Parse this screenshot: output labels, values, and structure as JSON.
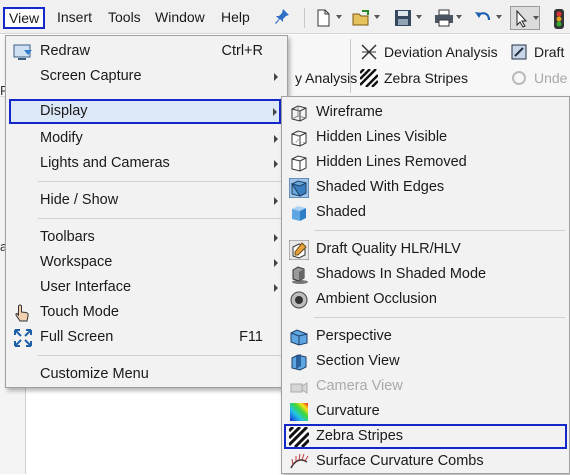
{
  "menubar": {
    "items": [
      {
        "label": "View"
      },
      {
        "label": "Insert"
      },
      {
        "label": "Tools"
      },
      {
        "label": "Window"
      },
      {
        "label": "Help"
      }
    ]
  },
  "ribbon": {
    "deviation_analysis": "Deviation Analysis",
    "draft": "Draft",
    "analysis_partial": "y Analysis",
    "zebra_stripes": "Zebra Stripes",
    "undercut_partial": "Unde"
  },
  "left_stubs": [
    "P",
    "a",
    "e",
    "i",
    "c",
    "a"
  ],
  "view_menu": {
    "items": [
      {
        "label": "Redraw",
        "shortcut": "Ctrl+R"
      },
      {
        "label": "Screen Capture"
      },
      {
        "label": "Display"
      },
      {
        "label": "Modify"
      },
      {
        "label": "Lights and Cameras"
      },
      {
        "label": "Hide / Show"
      },
      {
        "label": "Toolbars"
      },
      {
        "label": "Workspace"
      },
      {
        "label": "User Interface"
      },
      {
        "label": "Touch Mode"
      },
      {
        "label": "Full Screen",
        "shortcut": "F11"
      },
      {
        "label": "Customize Menu"
      }
    ]
  },
  "display_menu": {
    "items": [
      {
        "label": "Wireframe"
      },
      {
        "label": "Hidden Lines Visible"
      },
      {
        "label": "Hidden Lines Removed"
      },
      {
        "label": "Shaded With Edges"
      },
      {
        "label": "Shaded"
      },
      {
        "label": "Draft Quality HLR/HLV"
      },
      {
        "label": "Shadows In Shaded Mode"
      },
      {
        "label": "Ambient Occlusion"
      },
      {
        "label": "Perspective"
      },
      {
        "label": "Section View"
      },
      {
        "label": "Camera View"
      },
      {
        "label": "Curvature"
      },
      {
        "label": "Zebra Stripes"
      },
      {
        "label": "Surface Curvature Combs"
      }
    ]
  },
  "colors": {
    "highlight_box": "#1427c8",
    "hover": "#dce8f7",
    "menu_bg": "#f2f2f2"
  }
}
